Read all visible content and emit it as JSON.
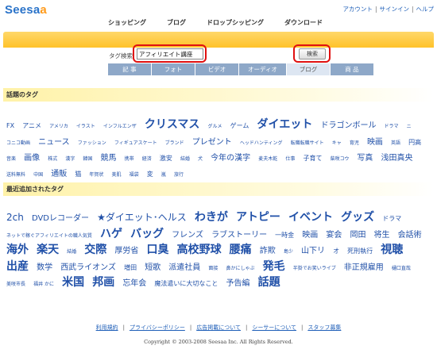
{
  "brand": {
    "name_main": "Seesa",
    "name_end": "a"
  },
  "top_links": [
    "アカウント",
    "サインイン",
    "ヘルプ"
  ],
  "nav": [
    "ショッピング",
    "ブログ",
    "ドロップシッピング",
    "ダウンロード"
  ],
  "search": {
    "label": "タグ検索",
    "value": "アフィリエイト講座",
    "button": "検索"
  },
  "tabs": [
    {
      "label": "記 事",
      "selected": false
    },
    {
      "label": "フォト",
      "selected": false
    },
    {
      "label": "ビデオ",
      "selected": false
    },
    {
      "label": "オーディオ",
      "selected": false
    },
    {
      "label": "ブログ",
      "selected": true
    },
    {
      "label": "商 品",
      "selected": false
    }
  ],
  "hot_tags": {
    "title": "話題のタグ",
    "tags": [
      {
        "t": "FX",
        "s": 2
      },
      {
        "t": "アニメ",
        "s": 2
      },
      {
        "t": "アメリカ",
        "s": 1
      },
      {
        "t": "イラスト",
        "s": 1
      },
      {
        "t": "インフルエンザ",
        "s": 1
      },
      {
        "t": "クリスマス",
        "s": 5
      },
      {
        "t": "グルメ",
        "s": 1
      },
      {
        "t": "ゲーム",
        "s": 2
      },
      {
        "t": "ダイエット",
        "s": 5
      },
      {
        "t": "ドラゴンボール",
        "s": 3
      },
      {
        "t": "ドラマ",
        "s": 1
      },
      {
        "t": "ニ",
        "s": 1
      },
      {
        "t": "コニコ動画",
        "s": 1
      },
      {
        "t": "ニュース",
        "s": 3
      },
      {
        "t": "ファッション",
        "s": 1
      },
      {
        "t": "フィギュアスケート",
        "s": 1
      },
      {
        "t": "ブランド",
        "s": 1
      },
      {
        "t": "プレゼント",
        "s": 3
      },
      {
        "t": "ヘッドハンティング",
        "s": 1
      },
      {
        "t": "転職転職サイト",
        "s": 1
      },
      {
        "t": "キャ",
        "s": 1
      },
      {
        "t": "育児",
        "s": 1
      },
      {
        "t": "映画",
        "s": 3
      },
      {
        "t": "英語",
        "s": 1
      },
      {
        "t": "円高",
        "s": 2
      },
      {
        "t": "音楽",
        "s": 1
      },
      {
        "t": "画像",
        "s": 3
      },
      {
        "t": "株式",
        "s": 1
      },
      {
        "t": "漢字",
        "s": 1
      },
      {
        "t": "韓国",
        "s": 1
      },
      {
        "t": "競馬",
        "s": 3
      },
      {
        "t": "携帯",
        "s": 1
      },
      {
        "t": "経済",
        "s": 1
      },
      {
        "t": "激安",
        "s": 2
      },
      {
        "t": "結婚",
        "s": 1
      },
      {
        "t": "犬",
        "s": 1
      },
      {
        "t": "今年の漢字",
        "s": 3
      },
      {
        "t": "麦夫木乾",
        "s": 1
      },
      {
        "t": "仕事",
        "s": 1
      },
      {
        "t": "子育て",
        "s": 2
      },
      {
        "t": "柴咲コウ",
        "s": 1
      },
      {
        "t": "写真",
        "s": 3
      },
      {
        "t": "浅田真央",
        "s": 3
      },
      {
        "t": "送料無料",
        "s": 1
      },
      {
        "t": "中国",
        "s": 1
      },
      {
        "t": "通販",
        "s": 3
      },
      {
        "t": "猫",
        "s": 2
      },
      {
        "t": "年賀状",
        "s": 1
      },
      {
        "t": "美肌",
        "s": 1
      },
      {
        "t": "福袋",
        "s": 1
      },
      {
        "t": "変",
        "s": 2
      },
      {
        "t": "嵐",
        "s": 1
      },
      {
        "t": "旅行",
        "s": 1
      }
    ]
  },
  "recent_tags": {
    "title": "最近追加されたタグ",
    "tags": [
      {
        "t": "2ch",
        "s": 4
      },
      {
        "t": "DVDレコーダー",
        "s": 3
      },
      {
        "t": "★ダイエット･ヘルス",
        "s": 4
      },
      {
        "t": "わきが",
        "s": 5
      },
      {
        "t": "アトピー",
        "s": 5
      },
      {
        "t": "イベント",
        "s": 5
      },
      {
        "t": "グッズ",
        "s": 5
      },
      {
        "t": "ドラマ",
        "s": 2
      },
      {
        "t": "ネットで稼ぐアフィリエイトの職人気質",
        "s": 1
      },
      {
        "t": "ハゲ",
        "s": 5
      },
      {
        "t": "バッグ",
        "s": 5
      },
      {
        "t": "フレンズ",
        "s": 3
      },
      {
        "t": "ラブストーリー",
        "s": 3
      },
      {
        "t": "一時金",
        "s": 2
      },
      {
        "t": "映画",
        "s": 3
      },
      {
        "t": "宴会",
        "s": 3
      },
      {
        "t": "岡田",
        "s": 3
      },
      {
        "t": "将生",
        "s": 3
      },
      {
        "t": "会話術",
        "s": 3
      },
      {
        "t": "海外",
        "s": 5
      },
      {
        "t": "楽天",
        "s": 5
      },
      {
        "t": "結婚",
        "s": 1
      },
      {
        "t": "交際",
        "s": 5
      },
      {
        "t": "厚労省",
        "s": 3
      },
      {
        "t": "口臭",
        "s": 5
      },
      {
        "t": "高校野球",
        "s": 5
      },
      {
        "t": "腰痛",
        "s": 5
      },
      {
        "t": "詐欺",
        "s": 3
      },
      {
        "t": "島少",
        "s": 1
      },
      {
        "t": "山下リ",
        "s": 3
      },
      {
        "t": "オ",
        "s": 2
      },
      {
        "t": "死刑執行",
        "s": 2
      },
      {
        "t": "視聴",
        "s": 5
      },
      {
        "t": "出産",
        "s": 5
      },
      {
        "t": "数学",
        "s": 3
      },
      {
        "t": "西武ライオンズ",
        "s": 3
      },
      {
        "t": "増田",
        "s": 2
      },
      {
        "t": "短歌",
        "s": 3
      },
      {
        "t": "派遣社員",
        "s": 3
      },
      {
        "t": "面接",
        "s": 1
      },
      {
        "t": "鼻かにしゃぶ",
        "s": 1
      },
      {
        "t": "発毛",
        "s": 5
      },
      {
        "t": "半掛でお笑いライブ",
        "s": 1
      },
      {
        "t": "非正規雇用",
        "s": 3
      },
      {
        "t": "樋口直哉",
        "s": 1
      },
      {
        "t": "美咲市長",
        "s": 1
      },
      {
        "t": "福井 かに",
        "s": 1
      },
      {
        "t": "米国",
        "s": 5
      },
      {
        "t": "邦画",
        "s": 5
      },
      {
        "t": "忘年会",
        "s": 3
      },
      {
        "t": "魔法遣いに大切なこと",
        "s": 2
      },
      {
        "t": "予告編",
        "s": 3
      },
      {
        "t": "話題",
        "s": 5
      }
    ]
  },
  "footer": {
    "links": [
      "利用規約",
      "プライバシーポリシー",
      "広告掲載について",
      "シーサーについて",
      "スタッフ募集"
    ],
    "copyright": "Copyright © 2003-2008 Seesaa Inc. All Rights Reserved."
  },
  "colors": {
    "accent_bar": "#ffc229",
    "link": "#2050a8",
    "highlight_ring": "#e01010",
    "tab": "#8ea8c8"
  }
}
